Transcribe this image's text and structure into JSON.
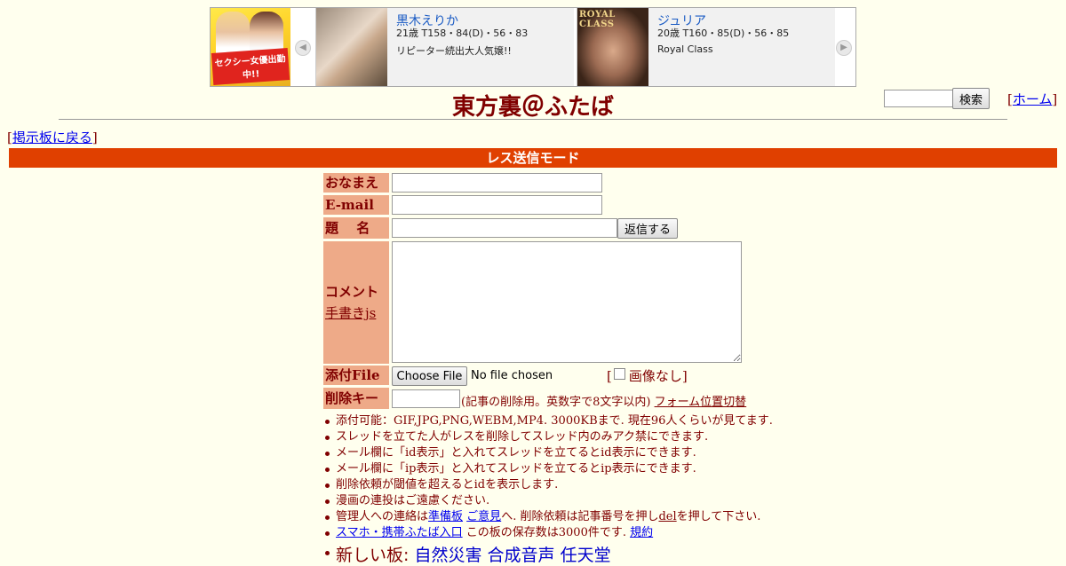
{
  "ad": {
    "promo_text": "セクシー女優出勤中!!",
    "prev_arrow": "◀",
    "next_arrow": "▶",
    "cards": [
      {
        "name": "黒木えりか",
        "stats": "21歳 T158・84(D)・56・83",
        "catch": "リピーター続出大人気嬢!!"
      },
      {
        "name": "ジュリア",
        "stats": "20歳 T160・85(D)・56・85",
        "catch": "Royal Class",
        "photo_label": "ROYAL CLASS"
      }
    ]
  },
  "header": {
    "title": "東方裏＠ふたば",
    "search_placeholder": "",
    "search_button": "検索",
    "home_open": "[",
    "home_link": "ホーム",
    "home_close": "]"
  },
  "nav": {
    "back_open": "[",
    "back_link": "掲示板に戻る",
    "back_close": "]"
  },
  "mode_bar": "レス送信モード",
  "form": {
    "name_label": "おなまえ",
    "email_label": "E-mail",
    "subject_label": "題　 名",
    "send_button": "返信する",
    "comment_label": "コメント",
    "tegaki_link": "手書きjs",
    "file_label": "添付File",
    "choose_file": "Choose File",
    "no_file": "No file chosen",
    "no_image_open": "[",
    "no_image_label": "画像なし]",
    "delkey_label": "削除キー",
    "delkey_note": "(記事の削除用。英数字で8文字以内)",
    "form_position_link": "フォーム位置切替"
  },
  "notes": {
    "n1": "添付可能：GIF,JPG,PNG,WEBM,MP4. 3000KBまで. 現在96人くらいが見てます.",
    "n2": "スレッドを立てた人がレスを削除してスレッド内のみアク禁にできます.",
    "n3": "メール欄に「id表示」と入れてスレッドを立てるとid表示にできます.",
    "n4": "メール欄に「ip表示」と入れてスレッドを立てるとip表示にできます.",
    "n5": "削除依頼が閾値を超えるとidを表示します.",
    "n6": "漫画の連投はご遠慮ください.",
    "n7_pre": "管理人への連絡は",
    "n7_link1": "準備板",
    "n7_link2": "ご意見",
    "n7_mid": "へ. 削除依頼は記事番号を押し",
    "n7_del": "del",
    "n7_post": "を押して下さい.",
    "n8_link": "スマホ・携帯ふたば入口",
    "n8_mid": " この板の保存数は3000件です. ",
    "n8_rules": "規約",
    "new_boards_label": "新しい板: ",
    "new_boards": [
      "自然災害",
      "合成音声",
      "任天堂"
    ]
  }
}
